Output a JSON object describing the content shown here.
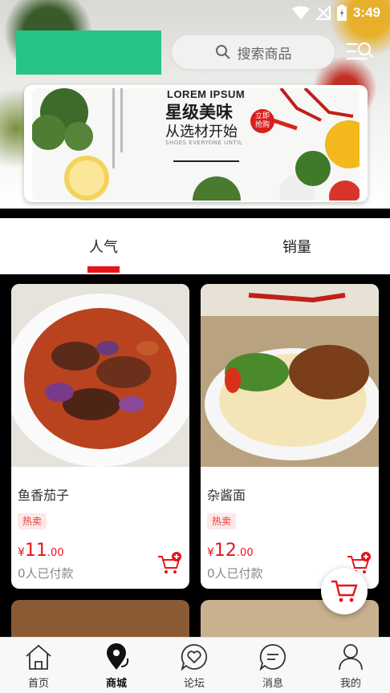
{
  "status_bar": {
    "time": "3:49"
  },
  "search": {
    "placeholder_text": "搜索商品"
  },
  "banner": {
    "lorem": "LOREM IPSUM",
    "title": "星级美味",
    "subtitle": "从选材开始",
    "small_text": "SHOES EVERYONE UNTIL",
    "badge_line1": "立即",
    "badge_line2": "抢购"
  },
  "tabs": [
    {
      "label": "人气",
      "active": true
    },
    {
      "label": "销量",
      "active": false
    }
  ],
  "products": [
    {
      "name": "鱼香茄子",
      "tag": "热卖",
      "currency": "¥",
      "price_int": "11",
      "price_dec": ".00",
      "sold": "0人已付款"
    },
    {
      "name": "杂酱面",
      "tag": "热卖",
      "currency": "¥",
      "price_int": "12",
      "price_dec": ".00",
      "sold": "0人已付款"
    }
  ],
  "nav": [
    {
      "label": "首页",
      "icon": "home-icon",
      "active": false
    },
    {
      "label": "商城",
      "icon": "map-pin-icon",
      "active": true
    },
    {
      "label": "论坛",
      "icon": "heart-chat-icon",
      "active": false
    },
    {
      "label": "消息",
      "icon": "message-icon",
      "active": false
    },
    {
      "label": "我的",
      "icon": "user-icon",
      "active": false
    }
  ],
  "colors": {
    "accent": "#e8141a",
    "logo": "#27c487",
    "tag_bg": "#fde8e8"
  }
}
